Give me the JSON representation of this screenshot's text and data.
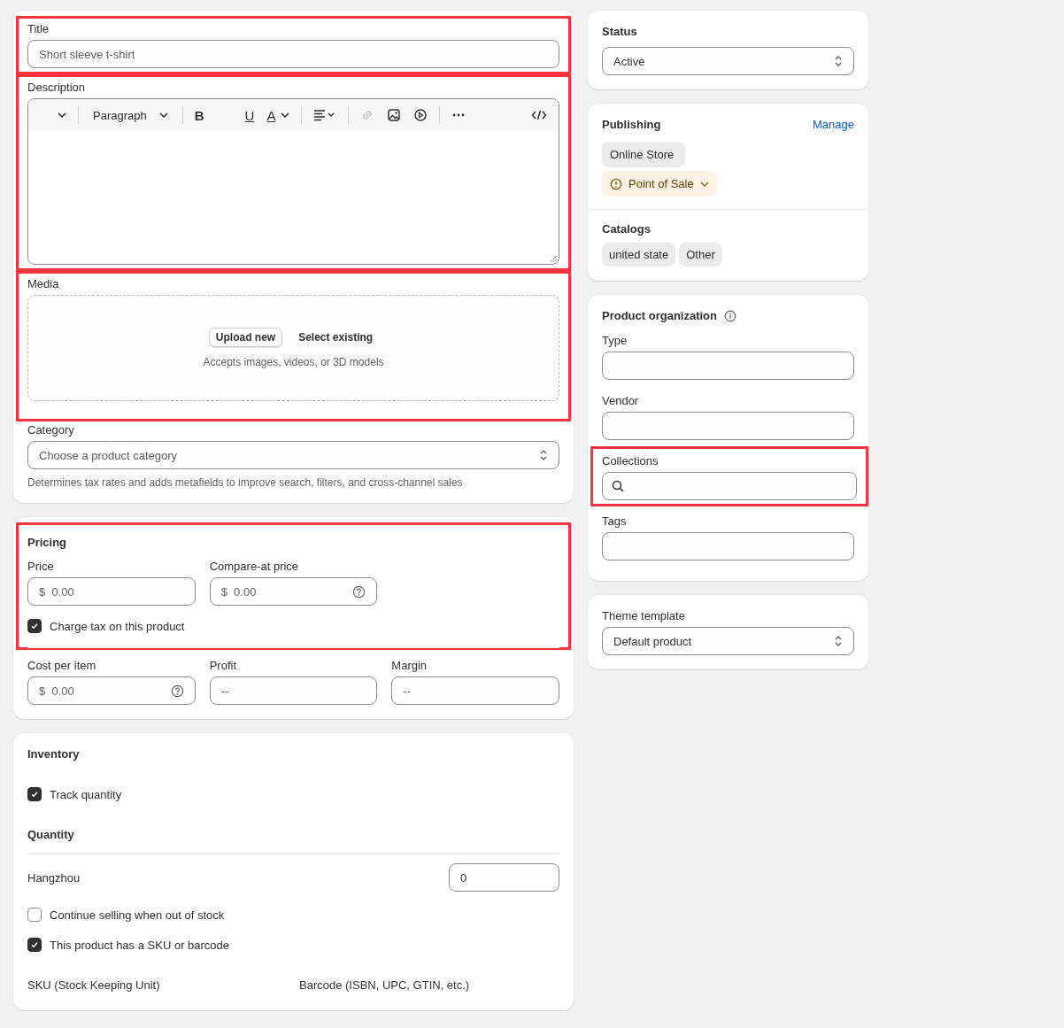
{
  "main": {
    "title": {
      "label": "Title",
      "value": "Short sleeve t-shirt",
      "highlighted": true
    },
    "description": {
      "label": "Description",
      "highlighted": true,
      "toolbar": [
        {
          "kind": "caret"
        },
        {
          "kind": "divider"
        },
        {
          "kind": "select",
          "label": "Paragraph"
        },
        {
          "kind": "divider"
        },
        {
          "kind": "glyph",
          "label": "B"
        },
        {
          "kind": "glyph",
          "label": "U"
        },
        {
          "kind": "glyph",
          "label": "A"
        },
        {
          "kind": "divider"
        },
        {
          "kind": "icon",
          "disabled": false
        },
        {
          "kind": "divider"
        },
        {
          "kind": "icon",
          "disabled": true
        },
        {
          "kind": "icon",
          "disabled": false
        },
        {
          "kind": "icon",
          "disabled": false
        },
        {
          "kind": "divider"
        },
        {
          "kind": "icon",
          "disabled": false
        },
        {
          "kind": "icon",
          "disabled": false
        }
      ]
    },
    "media": {
      "label": "Media",
      "highlighted": true,
      "upload": "Upload new",
      "select": "Select existing",
      "hint": "Accepts images, videos, or 3D models"
    },
    "category": {
      "label": "Category",
      "placeholder": "Choose a product category",
      "help": "Determines tax rates and adds metafields to improve search, filters, and cross-channel sales"
    }
  },
  "pricing": {
    "title": "Pricing",
    "highlighted": true,
    "fields": [
      {
        "label": "Price",
        "prefix": "$",
        "placeholder": "0.00",
        "help_icon": false
      },
      {
        "label": "Compare-at price",
        "prefix": "$",
        "placeholder": "0.00",
        "help_icon": true
      }
    ],
    "charge_tax": {
      "label": "Charge tax on this product",
      "checked": true
    },
    "cost_fields": [
      {
        "label": "Cost per item",
        "prefix": "$",
        "placeholder": "0.00",
        "help_icon": true
      },
      {
        "label": "Profit",
        "placeholder": "--",
        "help_icon": false
      },
      {
        "label": "Margin",
        "placeholder": "--",
        "help_icon": false
      }
    ]
  },
  "inventory": {
    "title": "Inventory",
    "track": {
      "label": "Track quantity",
      "checked": true
    },
    "quantity_title": "Quantity",
    "locations": [
      {
        "name": "Hangzhou",
        "value": "0"
      }
    ],
    "options": [
      {
        "label": "Continue selling when out of stock",
        "checked": false
      },
      {
        "label": "This product has a SKU or barcode",
        "checked": true
      }
    ],
    "sku_label": "SKU (Stock Keeping Unit)",
    "barcode_label": "Barcode (ISBN, UPC, GTIN, etc.)"
  },
  "status": {
    "title": "Status",
    "value": "Active"
  },
  "publishing": {
    "title": "Publishing",
    "manage": "Manage",
    "channels": [
      {
        "name": "Online Store",
        "warning": false
      },
      {
        "name": "Point of Sale",
        "warning": true
      }
    ],
    "catalogs_title": "Catalogs",
    "catalogs": [
      "united state",
      "Other"
    ]
  },
  "organization": {
    "title": "Product organization",
    "fields": [
      {
        "label": "Type",
        "kind": "text",
        "highlighted": false
      },
      {
        "label": "Vendor",
        "kind": "text",
        "highlighted": false
      },
      {
        "label": "Collections",
        "kind": "search",
        "highlighted": true
      },
      {
        "label": "Tags",
        "kind": "text",
        "highlighted": false
      }
    ]
  },
  "theme": {
    "title": "Theme template",
    "value": "Default product"
  }
}
